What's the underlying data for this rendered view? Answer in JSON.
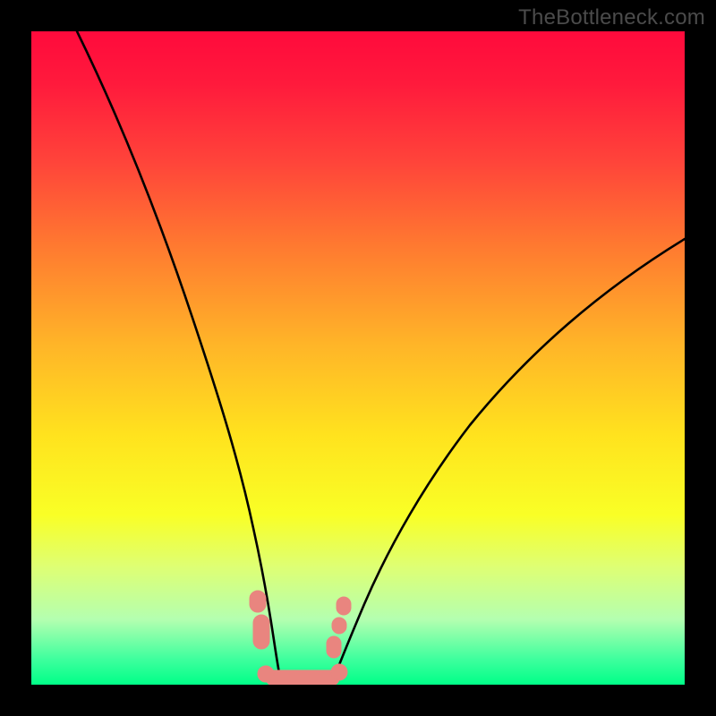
{
  "watermark": {
    "text": "TheBottleneck.com"
  },
  "chart_data": {
    "type": "line",
    "title": "",
    "xlabel": "",
    "ylabel": "",
    "xlim": [
      0,
      100
    ],
    "ylim": [
      0,
      100
    ],
    "series": [
      {
        "name": "left-curve",
        "x": [
          7,
          10,
          13,
          16,
          19,
          22,
          25,
          27,
          29,
          31,
          32.5,
          34,
          35,
          35.8,
          36.5,
          37.2,
          38
        ],
        "y": [
          100,
          88,
          76.5,
          65.5,
          55,
          45.2,
          36,
          29.5,
          23.5,
          18,
          13.8,
          10,
          7,
          4.6,
          3,
          1.6,
          0.8
        ]
      },
      {
        "name": "right-curve",
        "x": [
          46,
          47,
          48.5,
          50,
          52,
          55,
          58,
          62,
          66,
          71,
          76,
          82,
          88,
          94,
          100
        ],
        "y": [
          0.8,
          2,
          4.2,
          7,
          10.5,
          15.6,
          20.5,
          26.5,
          32,
          38.5,
          44.5,
          51,
          57,
          62.5,
          68
        ]
      },
      {
        "name": "valley-floor",
        "x": [
          38,
          40,
          42,
          44,
          46
        ],
        "y": [
          0.7,
          0.5,
          0.5,
          0.5,
          0.7
        ]
      }
    ],
    "markers": [
      {
        "series": "left-band",
        "x_center": 34.5,
        "y_range": [
          6.5,
          13.5
        ]
      },
      {
        "series": "right-band",
        "x_center": 48.5,
        "y_range": [
          5.5,
          12.5
        ]
      },
      {
        "series": "floor-band",
        "x_range": [
          36,
          47
        ],
        "y_center": 1.0
      }
    ],
    "gradient_stops": [
      {
        "pos": 0.0,
        "color": "#ff0a3c"
      },
      {
        "pos": 0.33,
        "color": "#ff7a30"
      },
      {
        "pos": 0.62,
        "color": "#ffe31e"
      },
      {
        "pos": 0.82,
        "color": "#deff74"
      },
      {
        "pos": 1.0,
        "color": "#00ff88"
      }
    ]
  }
}
